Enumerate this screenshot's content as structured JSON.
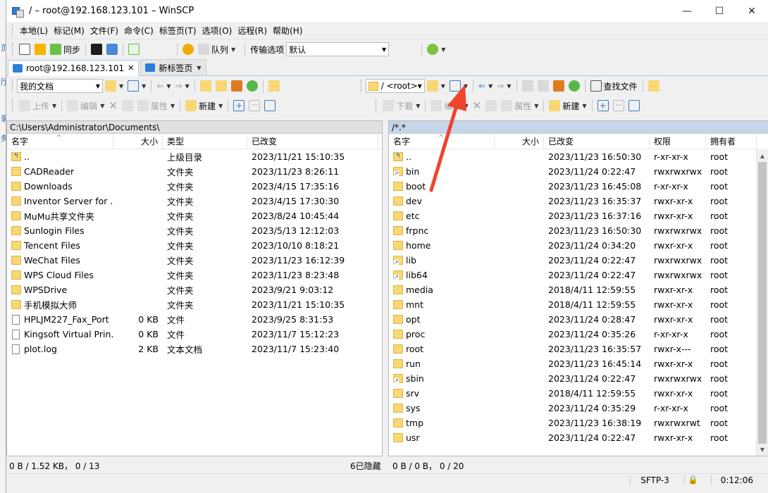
{
  "window": {
    "title": "/ – root@192.168.123.101 – WinSCP",
    "minimize": "—",
    "maximize": "☐",
    "close": "✕"
  },
  "background_strip": [
    "页",
    "厅",
    "录",
    "务"
  ],
  "menu": [
    "本地(L)",
    "标记(M)",
    "文件(F)",
    "命令(C)",
    "标签页(T)",
    "选项(O)",
    "远程(R)",
    "帮助(H)"
  ],
  "main_toolbar": {
    "sync_label": "同步",
    "queue_label": "队列",
    "transfer_options_label": "传输选项",
    "transfer_preset": "默认"
  },
  "tabs": [
    {
      "label": "root@192.168.123.101",
      "close": "✕",
      "active": true
    },
    {
      "label": "新标签页",
      "active": false
    }
  ],
  "left_panel": {
    "location": "我的文档",
    "upload_label": "上传",
    "edit_label": "编辑",
    "properties_label": "属性",
    "new_label": "新建",
    "path": "C:\\Users\\Administrator\\Documents\\",
    "columns": [
      "名字",
      "大小",
      "类型",
      "已改变"
    ],
    "rows": [
      {
        "name": "..",
        "size": "",
        "type": "上级目录",
        "modified": "2023/11/21 15:10:35",
        "icon": "up-folder-icon"
      },
      {
        "name": "CADReader",
        "size": "",
        "type": "文件夹",
        "modified": "2023/11/23 8:26:11",
        "icon": "folder-icon"
      },
      {
        "name": "Downloads",
        "size": "",
        "type": "文件夹",
        "modified": "2023/4/15 17:35:16",
        "icon": "folder-icon"
      },
      {
        "name": "Inventor Server for ...",
        "size": "",
        "type": "文件夹",
        "modified": "2023/4/15 17:30:30",
        "icon": "folder-icon"
      },
      {
        "name": "MuMu共享文件夹",
        "size": "",
        "type": "文件夹",
        "modified": "2023/8/24 10:45:44",
        "icon": "folder-icon"
      },
      {
        "name": "Sunlogin Files",
        "size": "",
        "type": "文件夹",
        "modified": "2023/5/13 12:12:03",
        "icon": "folder-icon"
      },
      {
        "name": "Tencent Files",
        "size": "",
        "type": "文件夹",
        "modified": "2023/10/10 8:18:21",
        "icon": "folder-icon"
      },
      {
        "name": "WeChat Files",
        "size": "",
        "type": "文件夹",
        "modified": "2023/11/23 16:12:39",
        "icon": "folder-icon"
      },
      {
        "name": "WPS Cloud Files",
        "size": "",
        "type": "文件夹",
        "modified": "2023/11/23 8:23:48",
        "icon": "folder-icon"
      },
      {
        "name": "WPSDrive",
        "size": "",
        "type": "文件夹",
        "modified": "2023/9/21 9:03:12",
        "icon": "folder-icon"
      },
      {
        "name": "手机模拟大师",
        "size": "",
        "type": "文件夹",
        "modified": "2023/11/21 15:10:35",
        "icon": "folder-icon"
      },
      {
        "name": "HPLJM227_Fax_Port",
        "size": "0 KB",
        "type": "文件",
        "modified": "2023/9/25 8:31:53",
        "icon": "file-icon"
      },
      {
        "name": "Kingsoft Virtual Prin...",
        "size": "0 KB",
        "type": "文件",
        "modified": "2023/11/7 15:12:23",
        "icon": "file-icon"
      },
      {
        "name": "plot.log",
        "size": "2 KB",
        "type": "文本文档",
        "modified": "2023/11/7 15:23:40",
        "icon": "file-icon"
      }
    ],
    "status": "0 B / 1.52 KB，  0 / 13",
    "hidden": "6已隐藏"
  },
  "right_panel": {
    "location": "/ <root>",
    "download_label": "下载",
    "edit_label": "编辑",
    "properties_label": "属性",
    "new_label": "新建",
    "find_files_label": "查找文件",
    "path": "/*.*",
    "columns": [
      "名字",
      "大小",
      "已改变",
      "权限",
      "拥有者"
    ],
    "rows": [
      {
        "name": "..",
        "modified": "2023/11/23 16:50:30",
        "rights": "r-xr-xr-x",
        "owner": "root",
        "icon": "up-folder-icon"
      },
      {
        "name": "bin",
        "modified": "2023/11/24 0:22:47",
        "rights": "rwxrwxrwx",
        "owner": "root",
        "icon": "link-folder-icon"
      },
      {
        "name": "boot",
        "modified": "2023/11/23 16:45:08",
        "rights": "r-xr-xr-x",
        "owner": "root",
        "icon": "folder-icon"
      },
      {
        "name": "dev",
        "modified": "2023/11/23 16:35:37",
        "rights": "rwxr-xr-x",
        "owner": "root",
        "icon": "folder-icon"
      },
      {
        "name": "etc",
        "modified": "2023/11/23 16:37:16",
        "rights": "rwxr-xr-x",
        "owner": "root",
        "icon": "folder-icon"
      },
      {
        "name": "frpnc",
        "modified": "2023/11/23 16:50:30",
        "rights": "rwxrwxrwx",
        "owner": "root",
        "icon": "folder-icon"
      },
      {
        "name": "home",
        "modified": "2023/11/24 0:34:20",
        "rights": "rwxr-xr-x",
        "owner": "root",
        "icon": "folder-icon"
      },
      {
        "name": "lib",
        "modified": "2023/11/24 0:22:47",
        "rights": "rwxrwxrwx",
        "owner": "root",
        "icon": "link-folder-icon"
      },
      {
        "name": "lib64",
        "modified": "2023/11/24 0:22:47",
        "rights": "rwxrwxrwx",
        "owner": "root",
        "icon": "link-folder-icon"
      },
      {
        "name": "media",
        "modified": "2018/4/11 12:59:55",
        "rights": "rwxr-xr-x",
        "owner": "root",
        "icon": "folder-icon"
      },
      {
        "name": "mnt",
        "modified": "2018/4/11 12:59:55",
        "rights": "rwxr-xr-x",
        "owner": "root",
        "icon": "folder-icon"
      },
      {
        "name": "opt",
        "modified": "2023/11/24 0:28:47",
        "rights": "rwxr-xr-x",
        "owner": "root",
        "icon": "folder-icon"
      },
      {
        "name": "proc",
        "modified": "2023/11/24 0:35:26",
        "rights": "r-xr-xr-x",
        "owner": "root",
        "icon": "folder-icon"
      },
      {
        "name": "root",
        "modified": "2023/11/23 16:35:57",
        "rights": "rwxr-x---",
        "owner": "root",
        "icon": "folder-icon"
      },
      {
        "name": "run",
        "modified": "2023/11/23 16:45:14",
        "rights": "rwxr-xr-x",
        "owner": "root",
        "icon": "folder-icon"
      },
      {
        "name": "sbin",
        "modified": "2023/11/24 0:22:47",
        "rights": "rwxrwxrwx",
        "owner": "root",
        "icon": "link-folder-icon"
      },
      {
        "name": "srv",
        "modified": "2018/4/11 12:59:55",
        "rights": "rwxr-xr-x",
        "owner": "root",
        "icon": "folder-icon"
      },
      {
        "name": "sys",
        "modified": "2023/11/24 0:35:29",
        "rights": "r-xr-xr-x",
        "owner": "root",
        "icon": "folder-icon"
      },
      {
        "name": "tmp",
        "modified": "2023/11/23 16:38:19",
        "rights": "rwxrwxrwt",
        "owner": "root",
        "icon": "folder-icon"
      },
      {
        "name": "usr",
        "modified": "2023/11/24 0:22:47",
        "rights": "rwxr-xr-x",
        "owner": "root",
        "icon": "folder-icon"
      }
    ],
    "status": "0 B / 0 B，  0 / 20"
  },
  "connection": {
    "protocol": "SFTP-3",
    "elapsed": "0:12:06"
  },
  "colors": {
    "annotation_arrow": "#f0442c",
    "folder": "#f8d775",
    "right_path_bg": "#c6d5e8"
  }
}
